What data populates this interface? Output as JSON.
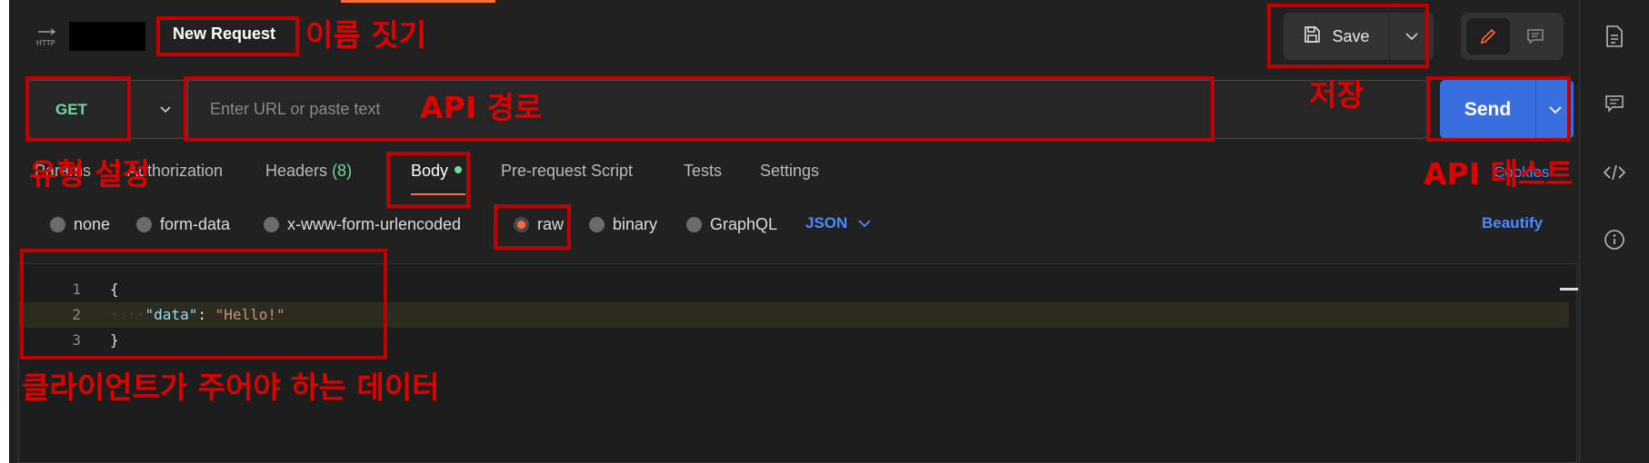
{
  "request": {
    "title": "New Request",
    "method": "GET",
    "url_placeholder": "Enter URL or paste text"
  },
  "toolbar": {
    "save_label": "Save",
    "send_label": "Send"
  },
  "tabs": [
    {
      "label": "Params"
    },
    {
      "label": "Authorization"
    },
    {
      "label": "Headers",
      "count": "(8)"
    },
    {
      "label": "Body"
    },
    {
      "label": "Pre-request Script"
    },
    {
      "label": "Tests"
    },
    {
      "label": "Settings"
    }
  ],
  "cookies_label": "Cookies",
  "body_types": [
    {
      "label": "none",
      "selected": false
    },
    {
      "label": "form-data",
      "selected": false
    },
    {
      "label": "x-www-form-urlencoded",
      "selected": false
    },
    {
      "label": "raw",
      "selected": true
    },
    {
      "label": "binary",
      "selected": false
    },
    {
      "label": "GraphQL",
      "selected": false
    }
  ],
  "format_label": "JSON",
  "beautify_label": "Beautify",
  "editor": {
    "lines": [
      {
        "num": "1",
        "text": "{"
      },
      {
        "num": "2",
        "key": "\"data\"",
        "sep": ": ",
        "value": "\"Hello!\""
      },
      {
        "num": "3",
        "text": "}"
      }
    ]
  },
  "annotations": {
    "name_label": "이름 짓기",
    "save_label": "저장",
    "api_path_label": "API 경로",
    "type_label": "유형 설정",
    "test_label": "API 테스트",
    "data_label": "클라이언트가 주어야 하는 데이터"
  },
  "colors": {
    "accent": "#ff6c37",
    "send": "#3a6fe0",
    "method_get": "#6bdd9a",
    "link": "#4a8cff",
    "annotation": "#c00000"
  }
}
